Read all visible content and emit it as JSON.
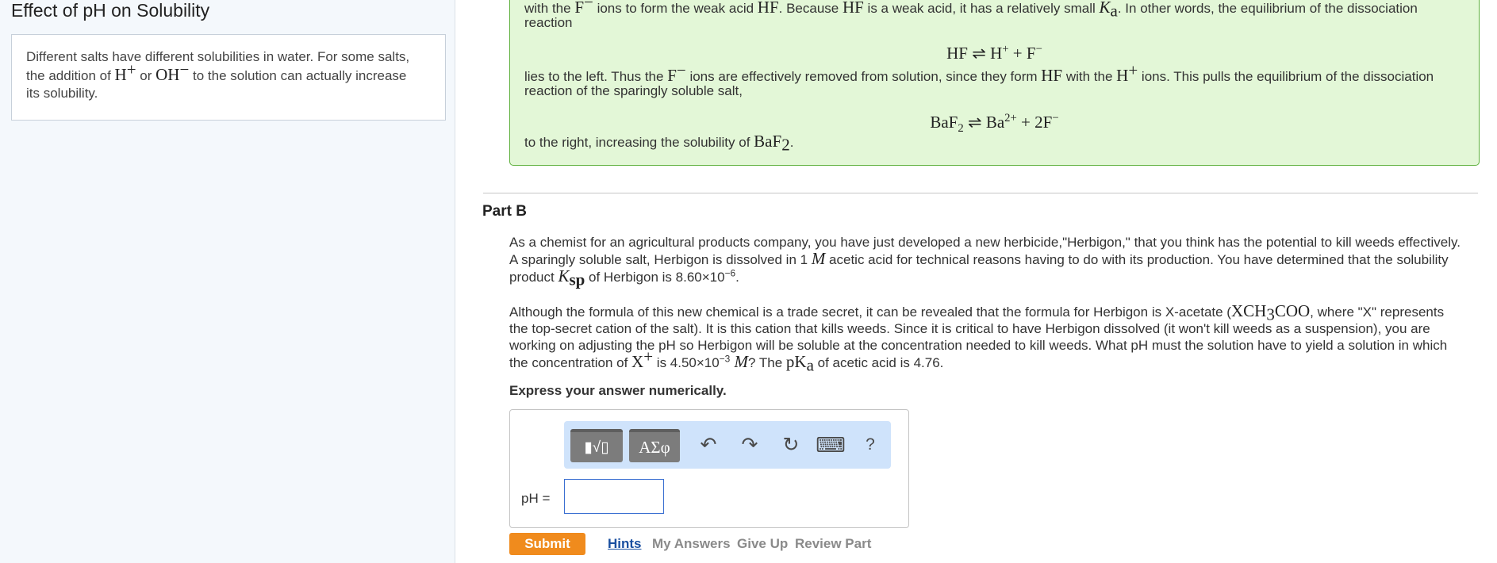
{
  "sidebar": {
    "title": "Effect of pH on Solubility",
    "intro_1": "Different salts have different solubilities in water. For some salts,",
    "intro_2a": "the addition of ",
    "intro_h": "H",
    "intro_h_sup": "+",
    "intro_or": " or ",
    "intro_oh": "OH",
    "intro_oh_sup": "−",
    "intro_2b": " to the solution can actually increase",
    "intro_3": "its solubility."
  },
  "explanation": {
    "l1a": "with the ",
    "f": "F",
    "minus": "−",
    "l1b": " ions to form the weak acid ",
    "hf": "HF",
    "l1c": ". Because ",
    "l1d": " is a weak acid, it has a relatively small ",
    "k": "K",
    "a_sub": "a",
    "l1e": ". In other words, the equilibrium of the dissociation",
    "l2": "reaction",
    "eq1": "HF ⇌ H",
    "eq1_sup": "+",
    "eq1_b": " + F",
    "eq1_sup2": "−",
    "l3a": "lies to the left. Thus the ",
    "l3b": " ions are effectively removed from solution, since they form ",
    "l3c": " with the ",
    "h": "H",
    "plus": "+",
    "l3d": " ions. This pulls the equilibrium of the dissociation",
    "l4": "reaction of the sparingly soluble salt,",
    "eq2a": "BaF",
    "eq2_sub": "2",
    "eq2b": " ⇌ Ba",
    "eq2_sup": "2+",
    "eq2c": " + 2F",
    "eq2_sup2": "−",
    "l5a": "to the right, increasing the solubility of ",
    "baf": "BaF",
    "baf_sub": "2",
    "l5b": "."
  },
  "part_b": {
    "title": "Part B",
    "p1_l1": "As a chemist for an agricultural products company, you have just developed a new herbicide,\"Herbigon,\" that you think has the potential to kill weeds effectively.",
    "p1_l2a": "A sparingly soluble salt, Herbigon is dissolved in 1 ",
    "m": "M",
    "p1_l2b": " acetic acid for technical reasons having to do with its production. You have determined that the solubility",
    "p1_l3a": "product ",
    "k": "K",
    "sp": "sp",
    "p1_l3b": " of Herbigon is 8.60×10",
    "p1_exp": "−6",
    "p1_l3c": ".",
    "p2_l1a": "Although the formula of this new chemical is a trade secret, it can be revealed that the formula for Herbigon is X-acetate (",
    "xch": "XCH",
    "xch_sub": "3",
    "coo": "COO",
    "p2_l1b": ", where \"X\" represents",
    "p2_l2": "the top-secret cation of the salt). It is this cation that kills weeds. Since it is critical to have Herbigon dissolved (it won't kill weeds as a suspension), you are",
    "p2_l3": "working on adjusting the pH so Herbigon will be soluble at the concentration needed to kill weeds. What pH must the solution have to yield a solution in which",
    "p2_l4a": "the concentration of ",
    "x": "X",
    "x_sup": "+",
    "p2_l4b": " is 4.50×10",
    "p2_exp": "−3",
    "p2_l4c": "? The ",
    "pk": "pK",
    "pk_sub": "a",
    "p2_l4d": " of acetic acid is 4.76.",
    "express": "Express your answer numerically."
  },
  "answer": {
    "label": "pH =",
    "value": "",
    "templates_glyph": "▮√▯",
    "symbols_glyph": "ΑΣφ",
    "undo_glyph": "↶",
    "redo_glyph": "↷",
    "reset_glyph": "↻",
    "keyboard_glyph": "⌨",
    "help_glyph": "?"
  },
  "actions": {
    "submit": "Submit",
    "hints": "Hints",
    "my_answers": "My Answers",
    "give_up": "Give Up",
    "review_part": "Review Part"
  },
  "colors": {
    "submit_bg": "#f08b1d",
    "explanation_bg": "#e3f7d7",
    "explanation_border": "#5fb13e",
    "toolbar_bg": "#cfe3fb"
  }
}
